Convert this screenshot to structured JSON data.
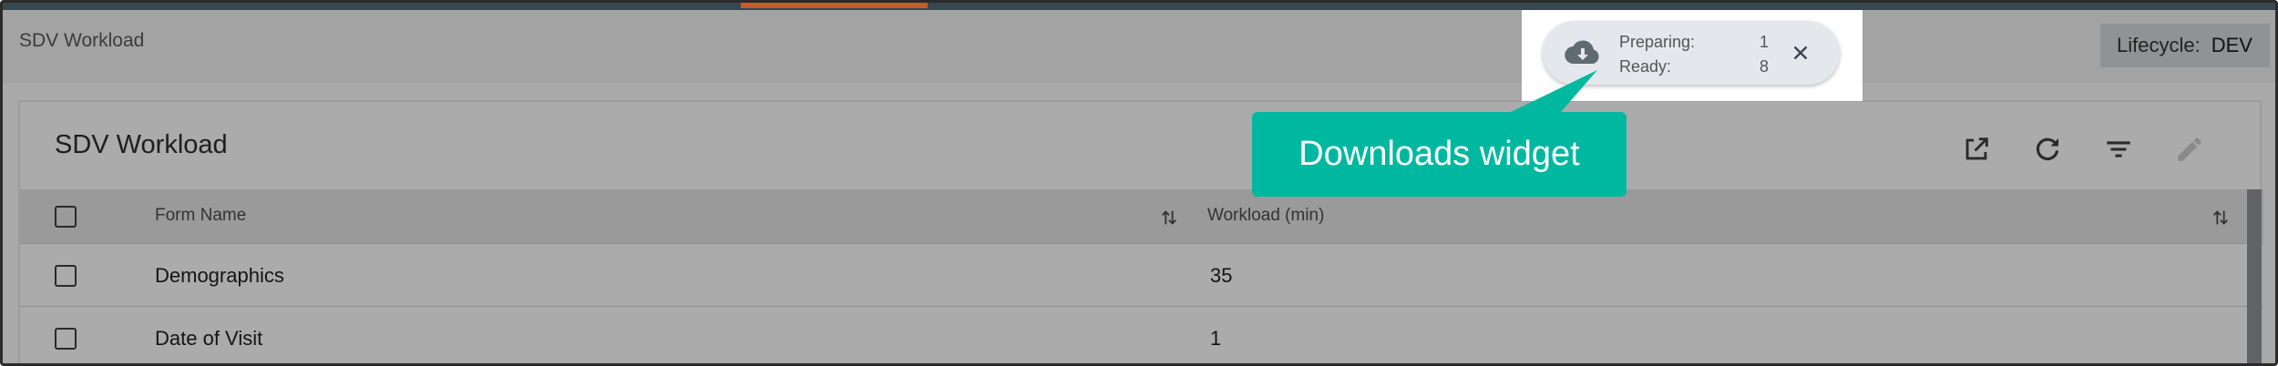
{
  "header": {
    "app_title": "SDV Workload",
    "lifecycle_label": "Lifecycle:",
    "lifecycle_value": "DEV"
  },
  "downloads_widget": {
    "preparing_label": "Preparing:",
    "preparing_count": "1",
    "ready_label": "Ready:",
    "ready_count": "8",
    "icons": {
      "cloud": "cloud-download-icon",
      "close": "close-icon"
    }
  },
  "callout": {
    "text": "Downloads widget",
    "color": "#00b8a0"
  },
  "panel": {
    "title": "SDV Workload",
    "toolbar": [
      "external-link-icon",
      "refresh-icon",
      "filter-icon",
      "edit-icon"
    ]
  },
  "table": {
    "columns": [
      "Form Name",
      "Workload (min)"
    ],
    "rows": [
      {
        "form_name": "Demographics",
        "workload": "35"
      },
      {
        "form_name": "Date of Visit",
        "workload": "1"
      }
    ]
  },
  "colors": {
    "accent": "#c75b2a",
    "topbar": "#37474f"
  }
}
